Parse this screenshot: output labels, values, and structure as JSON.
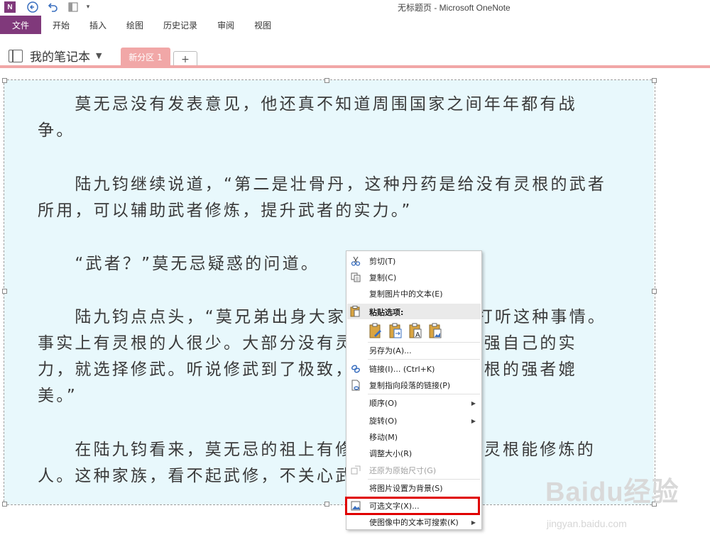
{
  "window": {
    "title": "无标题页 - Microsoft OneNote"
  },
  "quick_access": {
    "more_label": "▾"
  },
  "ribbon": {
    "file_label": "文件",
    "tabs": [
      "开始",
      "插入",
      "绘图",
      "历史记录",
      "审阅",
      "视图"
    ]
  },
  "notebook": {
    "name": "我的笔记本",
    "section_tab": "新分区 1",
    "add_tab_label": "+"
  },
  "document": {
    "paragraphs": [
      "　　莫无忌没有发表意见，他还真不知道周围国家之间年年都有战争。",
      "　　陆九钧继续说道，“第二是壮骨丹，这种丹药是给没有灵根的武者所用，可以辅助武者修炼，提升武者的实力。”",
      "　　“武者？”莫无忌疑惑的问道。",
      "　　陆九钧点点头，“莫兄弟出身大家族，自然不会去打听这种事情。事实上有灵根的人很少。大部分没有灵根的人，为了增强自己的实力，就选择修武。听说修武到了极致，一样可以和有灵根的强者媲美。”",
      "　　在陆九钧看来，莫无忌的祖上有修仙者，自然是有灵根能修炼的人。这种家族，看不起武修，不关心武者也是正常。"
    ]
  },
  "context_menu": {
    "cut": "剪切(T)",
    "copy": "复制(C)",
    "copy_text_from_picture": "复制图片中的文本(E)",
    "paste_options": "粘贴选项:",
    "save_as": "另存为(A)...",
    "link": "链接(I)...  (Ctrl+K)",
    "copy_link_to_paragraph": "复制指向段落的链接(P)",
    "order": "顺序(O)",
    "rotate": "旋转(O)",
    "move": "移动(M)",
    "resize": "调整大小(R)",
    "restore_size": "还原为原始尺寸(G)",
    "set_as_background": "将图片设置为背景(S)",
    "alt_text": "可选文字(X)...",
    "make_text_searchable": "使图像中的文本可搜索(K)"
  },
  "watermark": {
    "main": "Baidu经验",
    "sub": "jingyan.baidu.com"
  },
  "colors": {
    "accent": "#80397b",
    "section": "#f1a7a7",
    "image_bg": "#e8f8fc",
    "highlight": "#e00000"
  }
}
